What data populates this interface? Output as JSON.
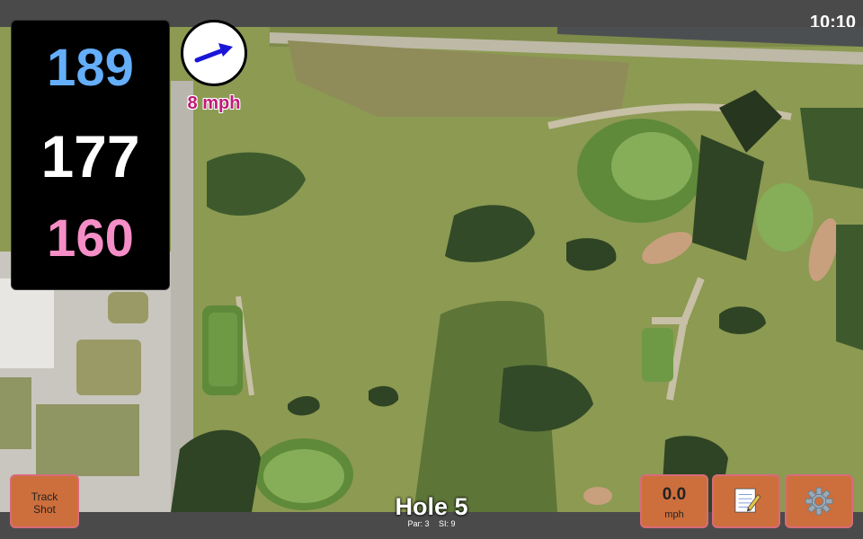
{
  "status_bar": {
    "time": "10:10"
  },
  "yardages": {
    "back": "189",
    "middle": "177",
    "front": "160"
  },
  "wind": {
    "speed": "8 mph"
  },
  "hole": {
    "title": "Hole 5",
    "par": "Par: 3",
    "si": "SI: 9"
  },
  "buttons": {
    "track_line1": "Track",
    "track_line2": "Shot",
    "speed_value": "0.0",
    "speed_unit": "mph"
  },
  "icons": {
    "notes": "notepad-icon",
    "settings": "gear-icon",
    "wind": "wind-arrow-icon"
  },
  "colors": {
    "back_yardage": "#64aefa",
    "middle_yardage": "#ffffff",
    "front_yardage": "#f58ec6",
    "wind_text": "#c2187a",
    "button_fill": "#cd6f3c",
    "arrow": "#1a16d8"
  }
}
